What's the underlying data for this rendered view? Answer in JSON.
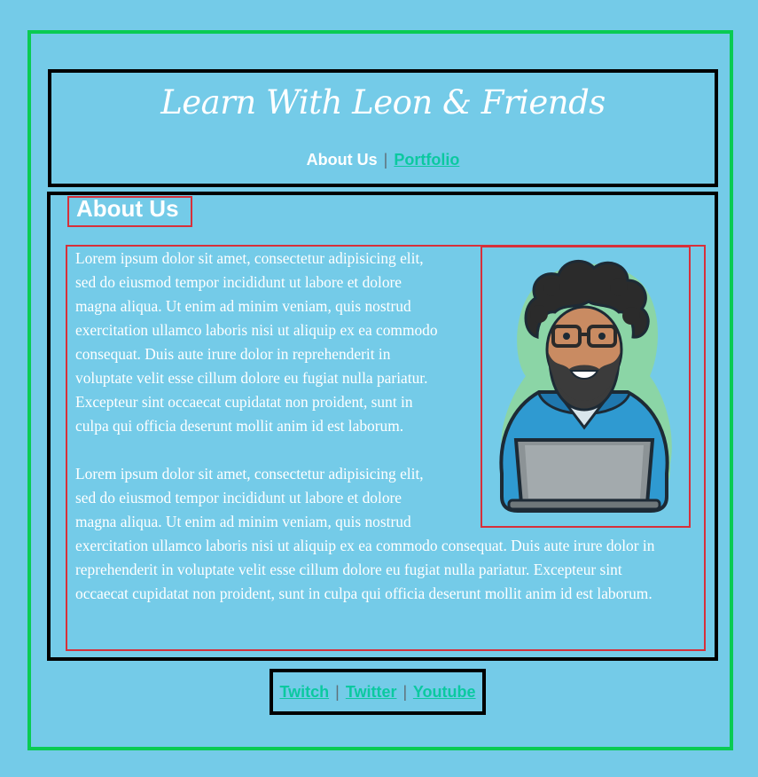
{
  "header": {
    "title": "Learn With Leon & Friends",
    "nav": {
      "about_label": "About Us",
      "separator": "|",
      "portfolio_label": "Portfolio"
    }
  },
  "main": {
    "heading": "About Us",
    "paragraphs": [
      "Lorem ipsum dolor sit amet, consectetur adipisicing elit, sed do eiusmod tempor incididunt ut labore et dolore magna aliqua. Ut enim ad minim veniam, quis nostrud exercitation ullamco laboris nisi ut aliquip ex ea commodo consequat. Duis aute irure dolor in reprehenderit in voluptate velit esse cillum dolore eu fugiat nulla pariatur. Excepteur sint occaecat cupidatat non proident, sunt in culpa qui officia deserunt mollit anim id est laborum.",
      "Lorem ipsum dolor sit amet, consectetur adipisicing elit, sed do eiusmod tempor incididunt ut labore et dolore magna aliqua. Ut enim ad minim veniam, quis nostrud exercitation ullamco laboris nisi ut aliquip ex ea commodo consequat. Duis aute irure dolor in reprehenderit in voluptate velit esse cillum dolore eu fugiat nulla pariatur. Excepteur sint occaecat cupidatat non proident, sunt in culpa qui officia deserunt mollit anim id est laborum."
    ],
    "avatar_icon": "developer-avatar-illustration"
  },
  "footer": {
    "links": [
      "Twitch",
      "Twitter",
      "Youtube"
    ],
    "separator": "|"
  },
  "colors": {
    "background": "#74CBE8",
    "outer_border": "#0ACB52",
    "section_border": "#000000",
    "debug_outline": "#D7303A",
    "link": "#0BC9A0",
    "text": "#FFFFFF"
  }
}
